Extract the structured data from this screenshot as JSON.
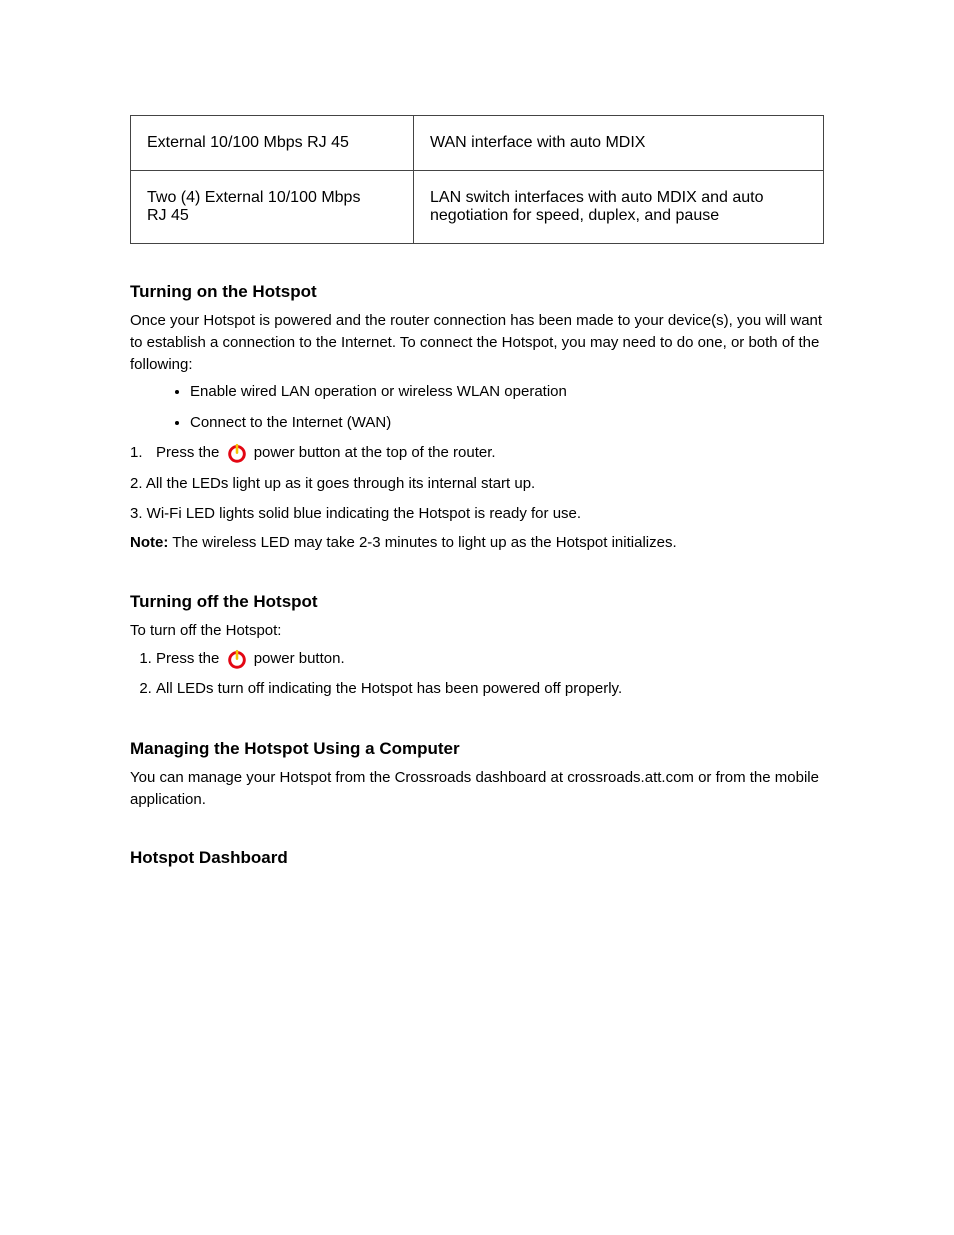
{
  "table": {
    "row1": {
      "left": "External 10/100 Mbps RJ 45",
      "right": "WAN interface with auto MDIX"
    },
    "row2": {
      "left_line1": "Two (4) External 10/100 Mbps",
      "left_line2": "RJ 45",
      "right_line1": "LAN switch interfaces with auto MDIX and auto",
      "right_line2": "negotiation for speed, duplex, and pause"
    }
  },
  "section1": {
    "heading": "Turning on the Hotspot",
    "intro": "Once your Hotspot is powered and the router connection has been made to your device(s), you will want to establish a connection to the Internet. To connect the Hotspot, you may need to do one, or both of the following:",
    "bullet1": "Enable wired LAN operation or wireless WLAN operation",
    "bullet2": "Connect to the Internet (WAN)",
    "step1_num": "1.",
    "step1_prefix": "Press the",
    "step1_suffix": "power button at the top of the router.",
    "step2": "2.  All the LEDs light up as it goes through its internal start up.",
    "step3": "3.  Wi-Fi LED lights solid blue indicating the Hotspot is ready for use.",
    "note_prefix": "Note:",
    "note_body": " The wireless LED may take 2-3 minutes to light up as the Hotspot initializes."
  },
  "section2": {
    "heading": "Turning off the Hotspot",
    "intro": "To turn off the Hotspot:",
    "step1_prefix": "Press the",
    "step1_suffix": "power button.",
    "step2": "All LEDs turn off indicating the Hotspot has been powered off properly."
  },
  "section3": {
    "heading": "Managing the Hotspot Using a Computer",
    "intro": "You can manage your Hotspot from the Crossroads dashboard at crossroads.att.com or from the mobile application.",
    "sub_heading": "Hotspot Dashboard"
  }
}
